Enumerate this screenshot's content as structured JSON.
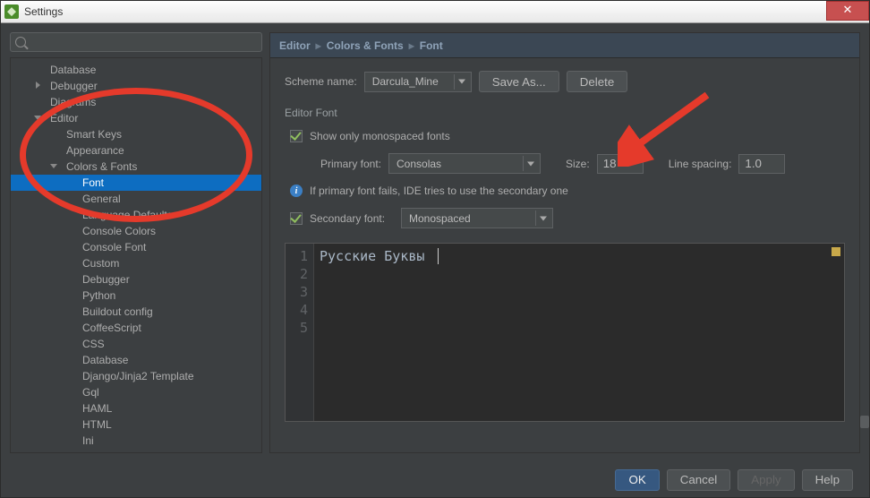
{
  "window": {
    "title": "Settings"
  },
  "search": {
    "placeholder": ""
  },
  "tree": {
    "items": [
      {
        "label": "Database",
        "cls": "indent1"
      },
      {
        "label": "Debugger",
        "cls": "indent1",
        "arrow": "right1"
      },
      {
        "label": "Diagrams",
        "cls": "indent1"
      },
      {
        "label": "Editor",
        "cls": "indent1",
        "arrow": "down1"
      },
      {
        "label": "Smart Keys",
        "cls": "indent2"
      },
      {
        "label": "Appearance",
        "cls": "indent2"
      },
      {
        "label": "Colors & Fonts",
        "cls": "indent2",
        "arrow": "down2"
      },
      {
        "label": "Font",
        "cls": "indent3",
        "selected": true
      },
      {
        "label": "General",
        "cls": "indent3"
      },
      {
        "label": "Language Defaults",
        "cls": "indent3"
      },
      {
        "label": "Console Colors",
        "cls": "indent3"
      },
      {
        "label": "Console Font",
        "cls": "indent3"
      },
      {
        "label": "Custom",
        "cls": "indent3"
      },
      {
        "label": "Debugger",
        "cls": "indent3"
      },
      {
        "label": "Python",
        "cls": "indent3"
      },
      {
        "label": "Buildout config",
        "cls": "indent3"
      },
      {
        "label": "CoffeeScript",
        "cls": "indent3"
      },
      {
        "label": "CSS",
        "cls": "indent3"
      },
      {
        "label": "Database",
        "cls": "indent3"
      },
      {
        "label": "Django/Jinja2 Template",
        "cls": "indent3"
      },
      {
        "label": "Gql",
        "cls": "indent3"
      },
      {
        "label": "HAML",
        "cls": "indent3"
      },
      {
        "label": "HTML",
        "cls": "indent3"
      },
      {
        "label": "Ini",
        "cls": "indent3"
      }
    ]
  },
  "breadcrumb": {
    "p1": "Editor",
    "p2": "Colors & Fonts",
    "p3": "Font"
  },
  "scheme": {
    "label": "Scheme name:",
    "value": "Darcula_Mine",
    "saveas": "Save As...",
    "delete": "Delete"
  },
  "editorFont": {
    "title": "Editor Font",
    "showMono": "Show only monospaced fonts",
    "primaryLabel": "Primary font:",
    "primaryValue": "Consolas",
    "sizeLabel": "Size:",
    "sizeValue": "18",
    "spacingLabel": "Line spacing:",
    "spacingValue": "1.0",
    "info": "If primary font fails, IDE tries to use the secondary one",
    "secondaryLabel": "Secondary font:",
    "secondaryValue": "Monospaced"
  },
  "preview": {
    "line1": "Русские Буквы",
    "gutter": [
      "1",
      "2",
      "3",
      "4",
      "5"
    ]
  },
  "footer": {
    "ok": "OK",
    "cancel": "Cancel",
    "apply": "Apply",
    "help": "Help"
  }
}
